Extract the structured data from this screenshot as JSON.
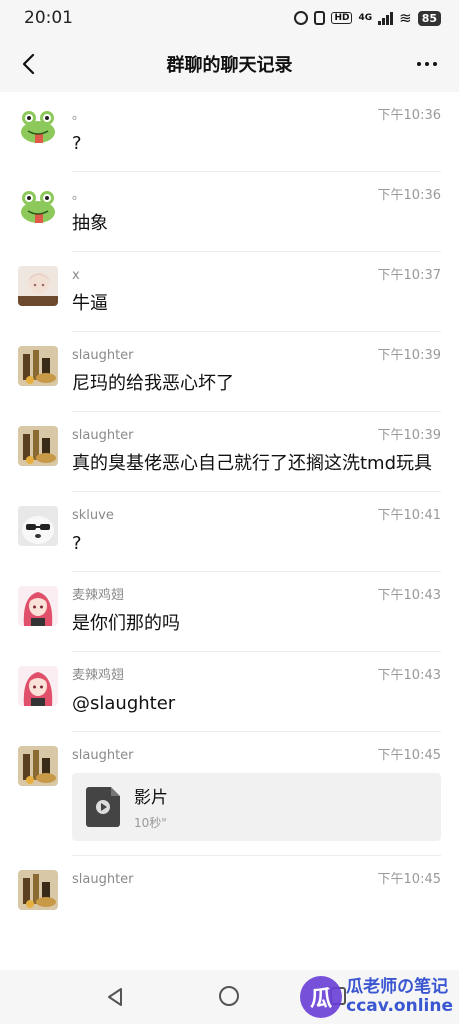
{
  "status_bar": {
    "time": "20:01",
    "network": "4G",
    "hd_label": "HD",
    "battery": "85"
  },
  "header": {
    "title": "群聊的聊天记录"
  },
  "messages": [
    {
      "sender": "。",
      "time": "下午10:36",
      "text": "?",
      "avatar": "frog-avatar"
    },
    {
      "sender": "。",
      "time": "下午10:36",
      "text": "抽象",
      "avatar": "frog-avatar"
    },
    {
      "sender": "x",
      "time": "下午10:37",
      "text": "牛逼",
      "avatar": "anime-avatar"
    },
    {
      "sender": "slaughter",
      "time": "下午10:39",
      "text": "尼玛的给我恶心坏了",
      "avatar": "bottles-avatar"
    },
    {
      "sender": "slaughter",
      "time": "下午10:39",
      "text": "真的臭基佬恶心自己就行了还搁这洗tmd玩具",
      "avatar": "bottles-avatar"
    },
    {
      "sender": "skluve",
      "time": "下午10:41",
      "text": "?",
      "avatar": "dog-avatar"
    },
    {
      "sender": "麦辣鸡翅",
      "time": "下午10:43",
      "text": "是你们那的吗",
      "avatar": "pink-hair-avatar"
    },
    {
      "sender": "麦辣鸡翅",
      "time": "下午10:43",
      "text": "@slaughter",
      "avatar": "pink-hair-avatar"
    },
    {
      "sender": "slaughter",
      "time": "下午10:45",
      "file_name": "影片",
      "file_duration": "10秒\"",
      "avatar": "bottles-avatar"
    },
    {
      "sender": "slaughter",
      "time": "下午10:45",
      "avatar": "bottles-avatar"
    }
  ],
  "watermark": {
    "line1": "瓜老师の笔记",
    "line2": "ccav.online",
    "logo": "瓜"
  },
  "colors": {
    "background": "#ffffff",
    "bar": "#f6f6f6",
    "secondary_text": "#8a8a8a",
    "watermark_accent": "#6a3fd8"
  }
}
